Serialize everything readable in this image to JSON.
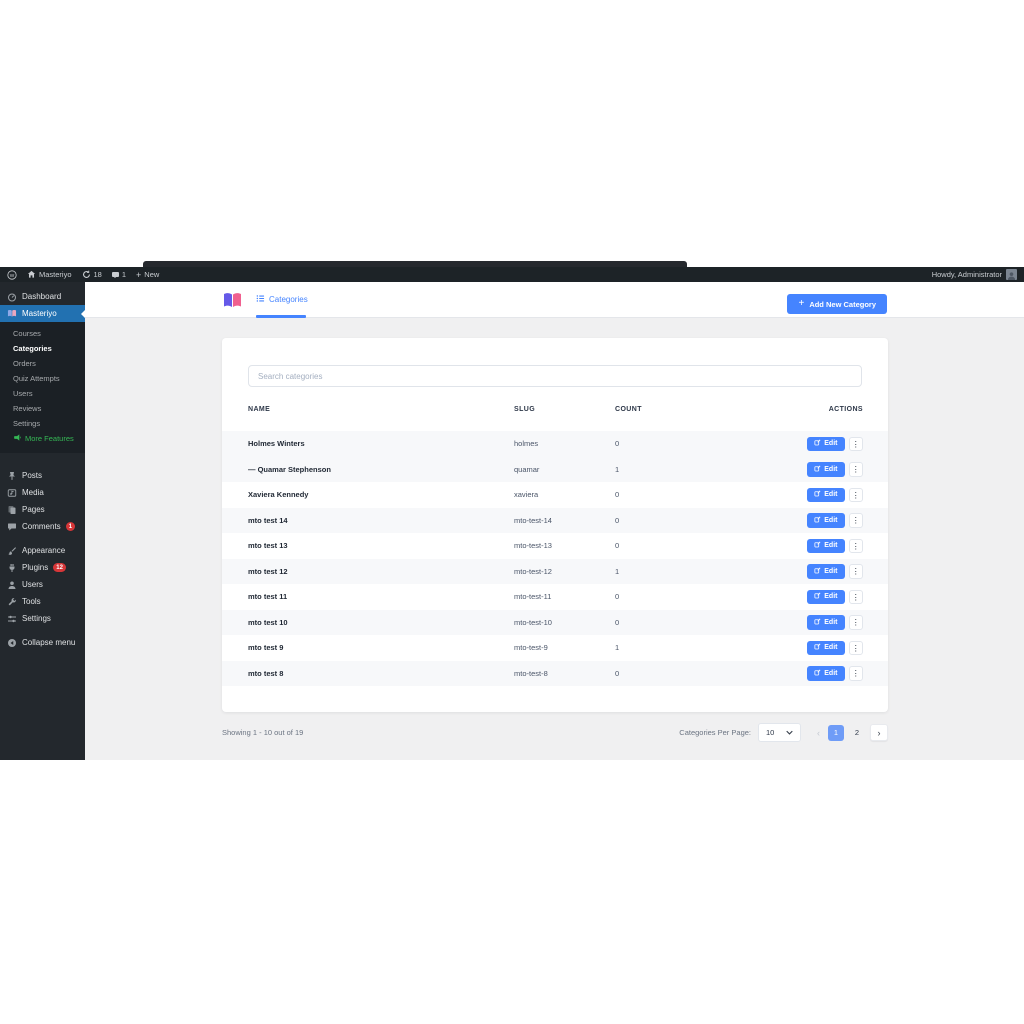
{
  "admin_bar": {
    "site_name": "Masteriyo",
    "updates_count": "18",
    "comments_count": "1",
    "new_label": "New",
    "howdy": "Howdy, Administrator"
  },
  "sidebar": {
    "items": [
      {
        "label": "Dashboard",
        "icon": "dashboard-icon"
      },
      {
        "label": "Masteriyo",
        "icon": "masteriyo-icon",
        "active": true,
        "submenu": [
          {
            "label": "Courses"
          },
          {
            "label": "Categories",
            "current": true
          },
          {
            "label": "Orders"
          },
          {
            "label": "Quiz Attempts"
          },
          {
            "label": "Users"
          },
          {
            "label": "Reviews"
          },
          {
            "label": "Settings"
          },
          {
            "label": "More Features",
            "promo": true,
            "icon": "megaphone-icon"
          }
        ]
      },
      {
        "label": "Posts",
        "icon": "posts-icon",
        "gap_before": true
      },
      {
        "label": "Media",
        "icon": "media-icon"
      },
      {
        "label": "Pages",
        "icon": "pages-icon"
      },
      {
        "label": "Comments",
        "icon": "comments-icon",
        "badge": "1"
      },
      {
        "label": "Appearance",
        "icon": "appearance-icon",
        "gap_before": true
      },
      {
        "label": "Plugins",
        "icon": "plugins-icon",
        "badge": "12"
      },
      {
        "label": "Users",
        "icon": "users-icon"
      },
      {
        "label": "Tools",
        "icon": "tools-icon"
      },
      {
        "label": "Settings",
        "icon": "settings-icon"
      },
      {
        "label": "Collapse menu",
        "icon": "collapse-icon",
        "gap_before": true
      }
    ]
  },
  "header": {
    "tab_label": "Categories",
    "add_button_label": "Add New Category"
  },
  "search": {
    "placeholder": "Search categories"
  },
  "table": {
    "columns": [
      "NAME",
      "SLUG",
      "COUNT",
      "ACTIONS"
    ],
    "edit_label": "Edit",
    "rows": [
      {
        "name": "Holmes Winters",
        "slug": "holmes",
        "count": "0",
        "child": false
      },
      {
        "name": "— Quamar Stephenson",
        "slug": "quamar",
        "count": "1",
        "child": true
      },
      {
        "name": "Xaviera Kennedy",
        "slug": "xaviera",
        "count": "0",
        "child": false
      },
      {
        "name": "mto test 14",
        "slug": "mto-test-14",
        "count": "0",
        "child": false
      },
      {
        "name": "mto test 13",
        "slug": "mto-test-13",
        "count": "0",
        "child": false
      },
      {
        "name": "mto test 12",
        "slug": "mto-test-12",
        "count": "1",
        "child": false
      },
      {
        "name": "mto test 11",
        "slug": "mto-test-11",
        "count": "0",
        "child": false
      },
      {
        "name": "mto test 10",
        "slug": "mto-test-10",
        "count": "0",
        "child": false
      },
      {
        "name": "mto test 9",
        "slug": "mto-test-9",
        "count": "1",
        "child": false
      },
      {
        "name": "mto test 8",
        "slug": "mto-test-8",
        "count": "0",
        "child": false
      }
    ]
  },
  "footer": {
    "showing_text": "Showing 1 - 10 out of 19",
    "per_page_label": "Categories Per Page:",
    "per_page_value": "10",
    "pages": [
      "1",
      "2"
    ],
    "active_page": "1",
    "prev_enabled": false
  },
  "colors": {
    "accent_blue": "#4584ff",
    "wp_active_blue": "#2271b1",
    "promo_green": "#35b755",
    "badge_red": "#d63638",
    "admin_bar_bg": "#1d2327",
    "sidebar_bg": "#23282d",
    "page_bg": "#f0f0f1",
    "stripe_bg": "#f7f8fa",
    "active_page_bg": "#6f9cf7",
    "logo_purple": "#6559e8",
    "logo_pink": "#f0608f"
  }
}
